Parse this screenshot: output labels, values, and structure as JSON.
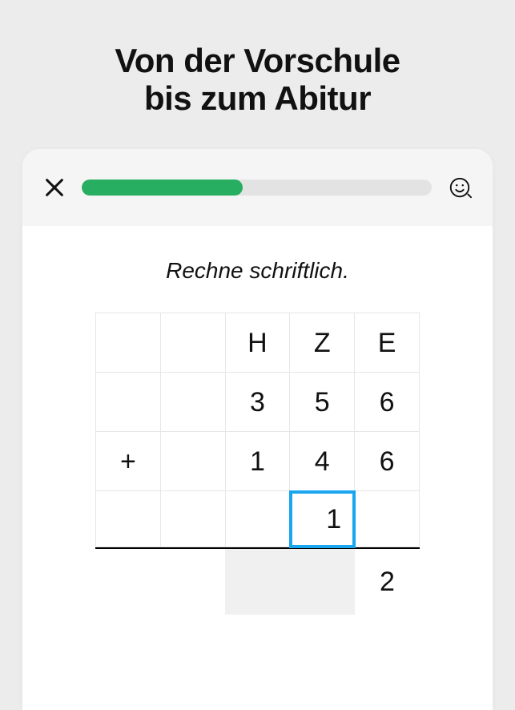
{
  "headline": {
    "line1": "Von der Vorschule",
    "line2": "bis zum Abitur"
  },
  "progress": {
    "percent": 46
  },
  "prompt": "Rechne schriftlich.",
  "table": {
    "header": [
      "",
      "",
      "H",
      "Z",
      "E"
    ],
    "addend1": [
      "",
      "",
      "3",
      "5",
      "6"
    ],
    "operator": "+",
    "addend2": [
      "",
      "1",
      "4",
      "6"
    ],
    "carry": [
      "",
      "",
      "",
      "1",
      ""
    ],
    "result": [
      "",
      "",
      "",
      "",
      "2"
    ]
  },
  "carry_active_index": 3,
  "colors": {
    "accent_green": "#27ae60",
    "active_blue": "#19a6ef"
  }
}
